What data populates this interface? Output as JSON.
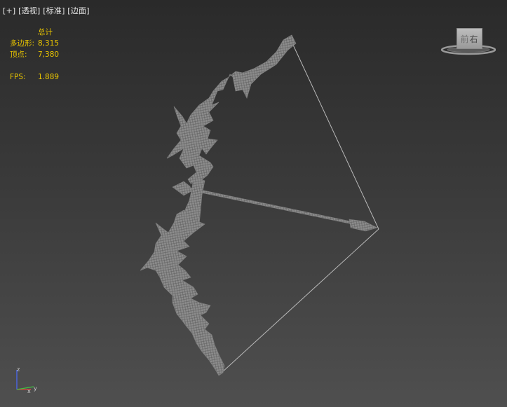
{
  "viewport": {
    "menu": {
      "plus_label": "[+]",
      "view_label": "[透视]",
      "shading_label": "[标准]",
      "edges_label": "[边面]"
    }
  },
  "stats": {
    "header": "总计",
    "polygons_label": "多边形:",
    "polygons_value": "8,315",
    "vertices_label": "顶点:",
    "vertices_value": "7,380",
    "fps_label": "FPS:",
    "fps_value": "1.889"
  },
  "viewcube": {
    "face_left": "前",
    "face_right": "右"
  },
  "axis_gizmo": {
    "z_label": "z",
    "x_label": "x",
    "y_label": "y"
  },
  "colors": {
    "stats_text": "#e8c400",
    "mesh": "#9a9a9a",
    "axis_z": "#4a6aff",
    "axis_x": "#e04040",
    "axis_y": "#40c040"
  },
  "icons": {
    "viewcube": "viewcube-icon",
    "axis": "axis-gizmo-icon"
  }
}
